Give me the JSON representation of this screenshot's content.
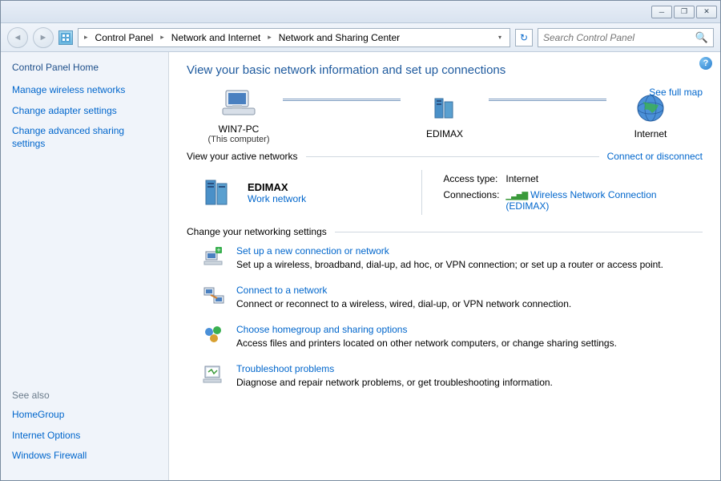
{
  "breadcrumb": {
    "items": [
      "Control Panel",
      "Network and Internet",
      "Network and Sharing Center"
    ]
  },
  "search": {
    "placeholder": "Search Control Panel"
  },
  "sidebar": {
    "home": "Control Panel Home",
    "links": [
      "Manage wireless networks",
      "Change adapter settings",
      "Change advanced sharing settings"
    ],
    "see_also_head": "See also",
    "see_also": [
      "HomeGroup",
      "Internet Options",
      "Windows Firewall"
    ]
  },
  "main": {
    "heading": "View your basic network information and set up connections",
    "full_map": "See full map",
    "map": {
      "node1": {
        "label": "WIN7-PC",
        "sub": "(This computer)"
      },
      "node2": {
        "label": "EDIMAX"
      },
      "node3": {
        "label": "Internet"
      }
    },
    "active_section": "View your active networks",
    "connect_link": "Connect or disconnect",
    "active_net": {
      "name": "EDIMAX",
      "type": "Work network",
      "access_label": "Access type:",
      "access_value": "Internet",
      "conn_label": "Connections:",
      "conn_value": "Wireless Network Connection (EDIMAX)"
    },
    "settings_section": "Change your networking settings",
    "tasks": [
      {
        "title": "Set up a new connection or network",
        "desc": "Set up a wireless, broadband, dial-up, ad hoc, or VPN connection; or set up a router or access point."
      },
      {
        "title": "Connect to a network",
        "desc": "Connect or reconnect to a wireless, wired, dial-up, or VPN network connection."
      },
      {
        "title": "Choose homegroup and sharing options",
        "desc": "Access files and printers located on other network computers, or change sharing settings."
      },
      {
        "title": "Troubleshoot problems",
        "desc": "Diagnose and repair network problems, or get troubleshooting information."
      }
    ]
  }
}
